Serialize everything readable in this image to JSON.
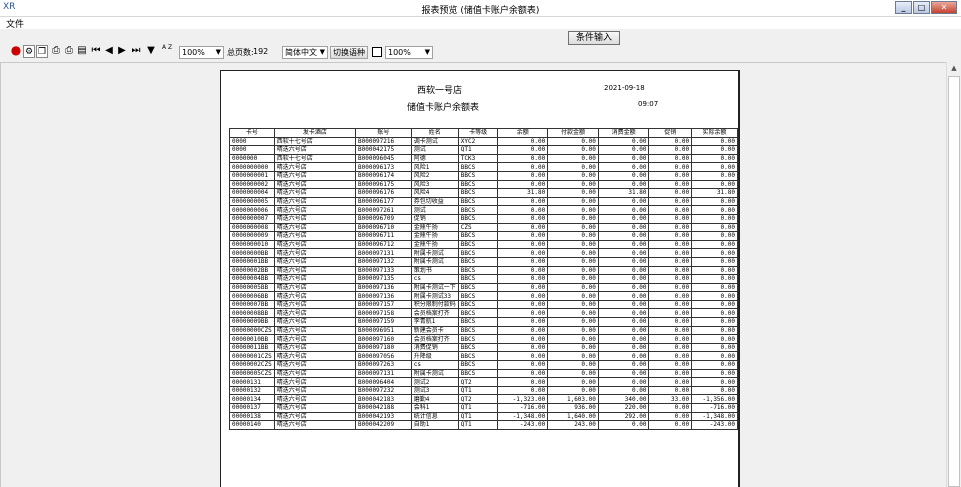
{
  "window": {
    "app_icon": "XR",
    "title": "报表预览 (储值卡账户余额表)",
    "min": "_",
    "max": "□",
    "close": "✕"
  },
  "menu": {
    "file": "文件"
  },
  "query_button": "条件输入",
  "toolbar": {
    "zoom": "100%",
    "total_pages_label": "总页数:",
    "total_pages": "192",
    "language": "简体中文",
    "switch_language": "切换语种",
    "zoom2": "100%",
    "sort_label": "A Z"
  },
  "report": {
    "store": "西软一号店",
    "title": "储值卡账户余额表",
    "date": "2021-09-18",
    "time": "09:07",
    "columns": [
      "卡号",
      "发卡酒店",
      "账号",
      "姓名",
      "卡等级",
      "余额",
      "付款金额",
      "消费金额",
      "促销",
      "实际余额"
    ],
    "rows": [
      [
        "0000",
        "西软十七号店",
        "B000097216",
        "调卡测试",
        "XYC2",
        "0.00",
        "0.00",
        "0.00",
        "0.00",
        "0.00"
      ],
      [
        "0000",
        "晴迭六号店",
        "B000042175",
        "测试",
        "QT1",
        "0.00",
        "0.00",
        "0.00",
        "0.00",
        "0.00"
      ],
      [
        "0000000",
        "西软十七号店",
        "B000096045",
        "阿德",
        "TCK3",
        "0.00",
        "0.00",
        "0.00",
        "0.00",
        "0.00"
      ],
      [
        "0000000000",
        "晴迭六号店",
        "B000096173",
        "风险1",
        "BBCS",
        "0.00",
        "0.00",
        "0.00",
        "0.00",
        "0.00"
      ],
      [
        "0000000001",
        "晴迭六号店",
        "B000096174",
        "风险2",
        "BBCS",
        "0.00",
        "0.00",
        "0.00",
        "0.00",
        "0.00"
      ],
      [
        "0000000002",
        "晴迭六号店",
        "B000096175",
        "风险3",
        "BBCS",
        "0.00",
        "0.00",
        "0.00",
        "0.00",
        "0.00"
      ],
      [
        "0000000004",
        "晴迭六号店",
        "B000096176",
        "风险4",
        "BBCS",
        "31.80",
        "0.00",
        "31.80",
        "0.00",
        "31.80"
      ],
      [
        "0000000005",
        "晴迭六号店",
        "B000096177",
        "券包切收益",
        "BBCS",
        "0.00",
        "0.00",
        "0.00",
        "0.00",
        "0.00"
      ],
      [
        "0000000006",
        "晴迭六号店",
        "B000097261",
        "测试",
        "BBCS",
        "0.00",
        "0.00",
        "0.00",
        "0.00",
        "0.00"
      ],
      [
        "0000000007",
        "晴迭六号店",
        "B000096709",
        "促销",
        "BBCS",
        "0.00",
        "0.00",
        "0.00",
        "0.00",
        "0.00"
      ],
      [
        "0000000008",
        "晴迭六号店",
        "B000096710",
        "金鼎牛扬",
        "CZS",
        "0.00",
        "0.00",
        "0.00",
        "0.00",
        "0.00"
      ],
      [
        "0000000009",
        "晴迭六号店",
        "B000096711",
        "金鼎牛扬",
        "BBCS",
        "0.00",
        "0.00",
        "0.00",
        "0.00",
        "0.00"
      ],
      [
        "0000000010",
        "晴迭六号店",
        "B000096712",
        "金鼎牛扬",
        "BBCS",
        "0.00",
        "0.00",
        "0.00",
        "0.00",
        "0.00"
      ],
      [
        "00000000BB",
        "晴迭六号店",
        "B000097131",
        "附属卡测试",
        "BBCS",
        "0.00",
        "0.00",
        "0.00",
        "0.00",
        "0.00"
      ],
      [
        "00000001BB",
        "晴迭六号店",
        "B000097132",
        "附属卡测试",
        "BBCS",
        "0.00",
        "0.00",
        "0.00",
        "0.00",
        "0.00"
      ],
      [
        "00000002BB",
        "晴迭六号店",
        "B000097133",
        "策划书",
        "BBCS",
        "0.00",
        "0.00",
        "0.00",
        "0.00",
        "0.00"
      ],
      [
        "00000004BB",
        "晴迭六号店",
        "B000097135",
        "cs",
        "BBCS",
        "0.00",
        "0.00",
        "0.00",
        "0.00",
        "0.00"
      ],
      [
        "00000005BB",
        "晴迭六号店",
        "B000097136",
        "附属卡测试一下",
        "BBCS",
        "0.00",
        "0.00",
        "0.00",
        "0.00",
        "0.00"
      ],
      [
        "00000006BB",
        "晴迭六号店",
        "B000097136",
        "附属卡测试33",
        "BBCS",
        "0.00",
        "0.00",
        "0.00",
        "0.00",
        "0.00"
      ],
      [
        "00000007BB",
        "晴迭六号店",
        "B000097157",
        "积分限制付款码",
        "BBCS",
        "0.00",
        "0.00",
        "0.00",
        "0.00",
        "0.00"
      ],
      [
        "00000008BB",
        "晴迭六号店",
        "B000097158",
        "会员档案打齐",
        "BBCS",
        "0.00",
        "0.00",
        "0.00",
        "0.00",
        "0.00"
      ],
      [
        "00000009BB",
        "晴迭六号店",
        "B000097159",
        "李青航1",
        "BBCS",
        "0.00",
        "0.00",
        "0.00",
        "0.00",
        "0.00"
      ],
      [
        "00000000CZS",
        "晴迭六号店",
        "B000096951",
        "新建会员卡",
        "BBCS",
        "0.00",
        "0.00",
        "0.00",
        "0.00",
        "0.00"
      ],
      [
        "00000010BB",
        "晴迭六号店",
        "B000097160",
        "会员档案打齐",
        "BBCS",
        "0.00",
        "0.00",
        "0.00",
        "0.00",
        "0.00"
      ],
      [
        "00000011BB",
        "晴迭六号店",
        "B000097180",
        "消费促销",
        "BBCS",
        "0.00",
        "0.00",
        "0.00",
        "0.00",
        "0.00"
      ],
      [
        "00000001CZS",
        "晴迭六号店",
        "B000097056",
        "升降级",
        "BBCS",
        "0.00",
        "0.00",
        "0.00",
        "0.00",
        "0.00"
      ],
      [
        "00000002CZS",
        "晴迭六号店",
        "B000097263",
        "cs",
        "BBCS",
        "0.00",
        "0.00",
        "0.00",
        "0.00",
        "0.00"
      ],
      [
        "00000005CZS",
        "晴迭六号店",
        "B000097131",
        "附属卡测试",
        "BBCS",
        "0.00",
        "0.00",
        "0.00",
        "0.00",
        "0.00"
      ],
      [
        "00000131",
        "晴迭六号店",
        "B000096404",
        "测试2",
        "QT2",
        "0.00",
        "0.00",
        "0.00",
        "0.00",
        "0.00"
      ],
      [
        "00000132",
        "晴迭六号店",
        "B000097232",
        "测试3",
        "QT1",
        "0.00",
        "0.00",
        "0.00",
        "0.00",
        "0.00"
      ],
      [
        "00000134",
        "晴迭六号店",
        "B000042183",
        "磨勤4",
        "QT2",
        "-1,323.00",
        "1,603.00",
        "340.00",
        "33.00",
        "-1,356.00"
      ],
      [
        "00000137",
        "晴迭六号店",
        "B000042188",
        "会科1",
        "QT1",
        "-716.00",
        "936.00",
        "220.00",
        "0.00",
        "-716.00"
      ],
      [
        "00000138",
        "晴迭六号店",
        "B000042193",
        "统计信息",
        "QT1",
        "-1,348.00",
        "1,640.00",
        "292.00",
        "0.00",
        "-1,348.00"
      ],
      [
        "00000140",
        "晴迭六号店",
        "B000042209",
        "自助1",
        "QT1",
        "-243.00",
        "243.00",
        "0.00",
        "0.00",
        "-243.00"
      ]
    ]
  }
}
